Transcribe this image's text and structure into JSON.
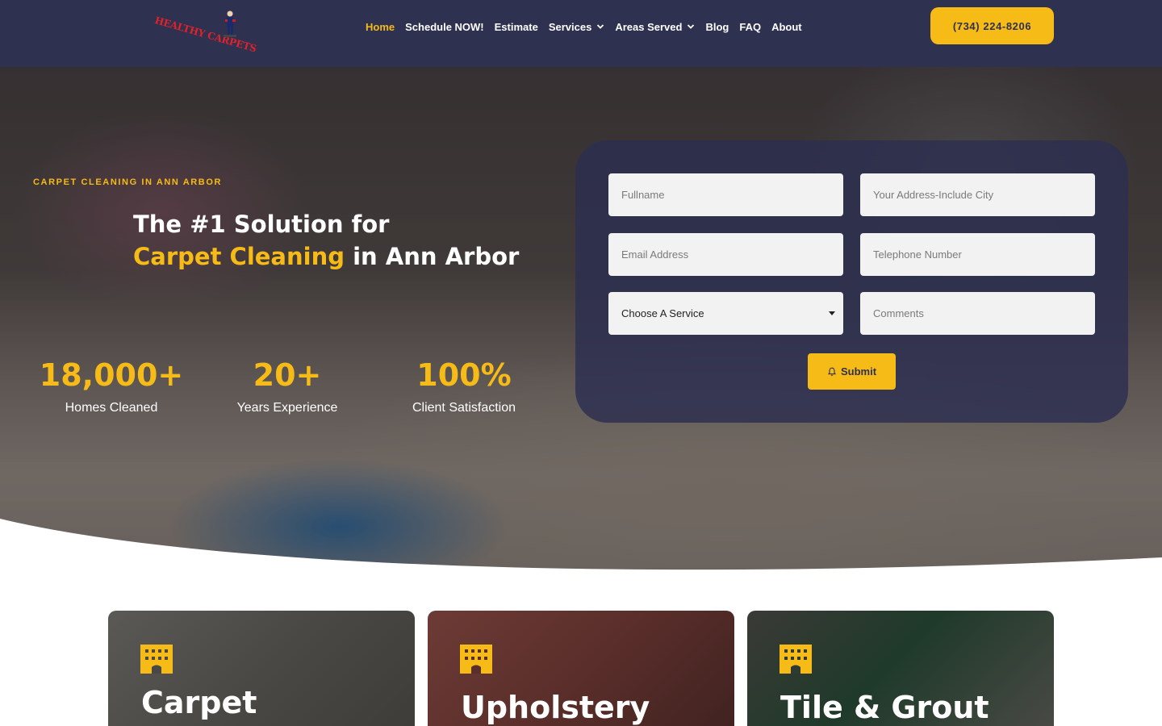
{
  "header": {
    "logo_text": "HEALTHY CARPETS",
    "nav": [
      {
        "label": "Home",
        "active": true,
        "dropdown": false
      },
      {
        "label": "Schedule NOW!",
        "active": false,
        "dropdown": false
      },
      {
        "label": "Estimate",
        "active": false,
        "dropdown": false
      },
      {
        "label": "Services",
        "active": false,
        "dropdown": true
      },
      {
        "label": "Areas Served",
        "active": false,
        "dropdown": true
      },
      {
        "label": "Blog",
        "active": false,
        "dropdown": false
      },
      {
        "label": "FAQ",
        "active": false,
        "dropdown": false
      },
      {
        "label": "About",
        "active": false,
        "dropdown": false
      }
    ],
    "phone": "(734) 224-8206"
  },
  "hero": {
    "eyebrow": "CARPET CLEANING IN ANN ARBOR",
    "headline_line1": "The #1 Solution for",
    "headline_highlight": "Carpet Cleaning",
    "headline_rest": " in Ann Arbor",
    "stats": [
      {
        "value": "18,000+",
        "label": "Homes Cleaned"
      },
      {
        "value": "20+",
        "label": "Years Experience"
      },
      {
        "value": "100%",
        "label": "Client Satisfaction"
      }
    ]
  },
  "form": {
    "fullname_placeholder": "Fullname",
    "address_placeholder": "Your Address-Include City",
    "email_placeholder": "Email Address",
    "phone_placeholder": "Telephone Number",
    "service_selected": "Choose A Service",
    "comments_placeholder": "Comments",
    "submit_label": "Submit"
  },
  "services": [
    {
      "title": "Carpet"
    },
    {
      "title": "Upholstery"
    },
    {
      "title": "Tile & Grout"
    }
  ],
  "colors": {
    "navy": "#2f3150",
    "accent": "#f7bb17",
    "logo_red": "#e0222b"
  }
}
